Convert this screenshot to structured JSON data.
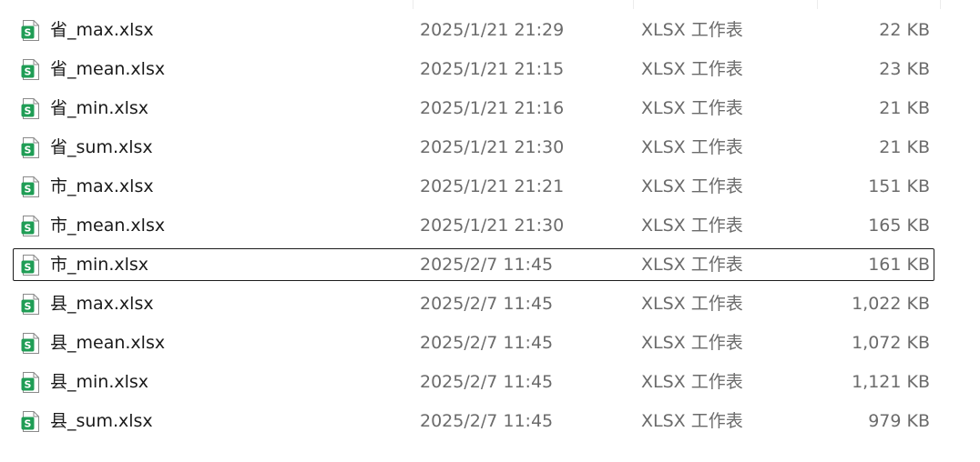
{
  "file_list": {
    "rows": [
      {
        "name": "省_max.xlsx",
        "date": "2025/1/21 21:29",
        "type": "XLSX 工作表",
        "size": "22 KB",
        "icon": "xlsx-file-icon",
        "focused": false
      },
      {
        "name": "省_mean.xlsx",
        "date": "2025/1/21 21:15",
        "type": "XLSX 工作表",
        "size": "23 KB",
        "icon": "xlsx-file-icon",
        "focused": false
      },
      {
        "name": "省_min.xlsx",
        "date": "2025/1/21 21:16",
        "type": "XLSX 工作表",
        "size": "21 KB",
        "icon": "xlsx-file-icon",
        "focused": false
      },
      {
        "name": "省_sum.xlsx",
        "date": "2025/1/21 21:30",
        "type": "XLSX 工作表",
        "size": "21 KB",
        "icon": "xlsx-file-icon",
        "focused": false
      },
      {
        "name": "市_max.xlsx",
        "date": "2025/1/21 21:21",
        "type": "XLSX 工作表",
        "size": "151 KB",
        "icon": "xlsx-file-icon",
        "focused": false
      },
      {
        "name": "市_mean.xlsx",
        "date": "2025/1/21 21:30",
        "type": "XLSX 工作表",
        "size": "165 KB",
        "icon": "xlsx-file-icon",
        "focused": false
      },
      {
        "name": "市_min.xlsx",
        "date": "2025/2/7 11:45",
        "type": "XLSX 工作表",
        "size": "161 KB",
        "icon": "xlsx-file-icon",
        "focused": true
      },
      {
        "name": "县_max.xlsx",
        "date": "2025/2/7 11:45",
        "type": "XLSX 工作表",
        "size": "1,022 KB",
        "icon": "xlsx-file-icon",
        "focused": false
      },
      {
        "name": "县_mean.xlsx",
        "date": "2025/2/7 11:45",
        "type": "XLSX 工作表",
        "size": "1,072 KB",
        "icon": "xlsx-file-icon",
        "focused": false
      },
      {
        "name": "县_min.xlsx",
        "date": "2025/2/7 11:45",
        "type": "XLSX 工作表",
        "size": "1,121 KB",
        "icon": "xlsx-file-icon",
        "focused": false
      },
      {
        "name": "县_sum.xlsx",
        "date": "2025/2/7 11:45",
        "type": "XLSX 工作表",
        "size": "979 KB",
        "icon": "xlsx-file-icon",
        "focused": false
      }
    ]
  },
  "colors": {
    "icon_green": "#1f9d55",
    "muted_text": "#6b6b6b",
    "focus_border": "#1c1c1c"
  }
}
